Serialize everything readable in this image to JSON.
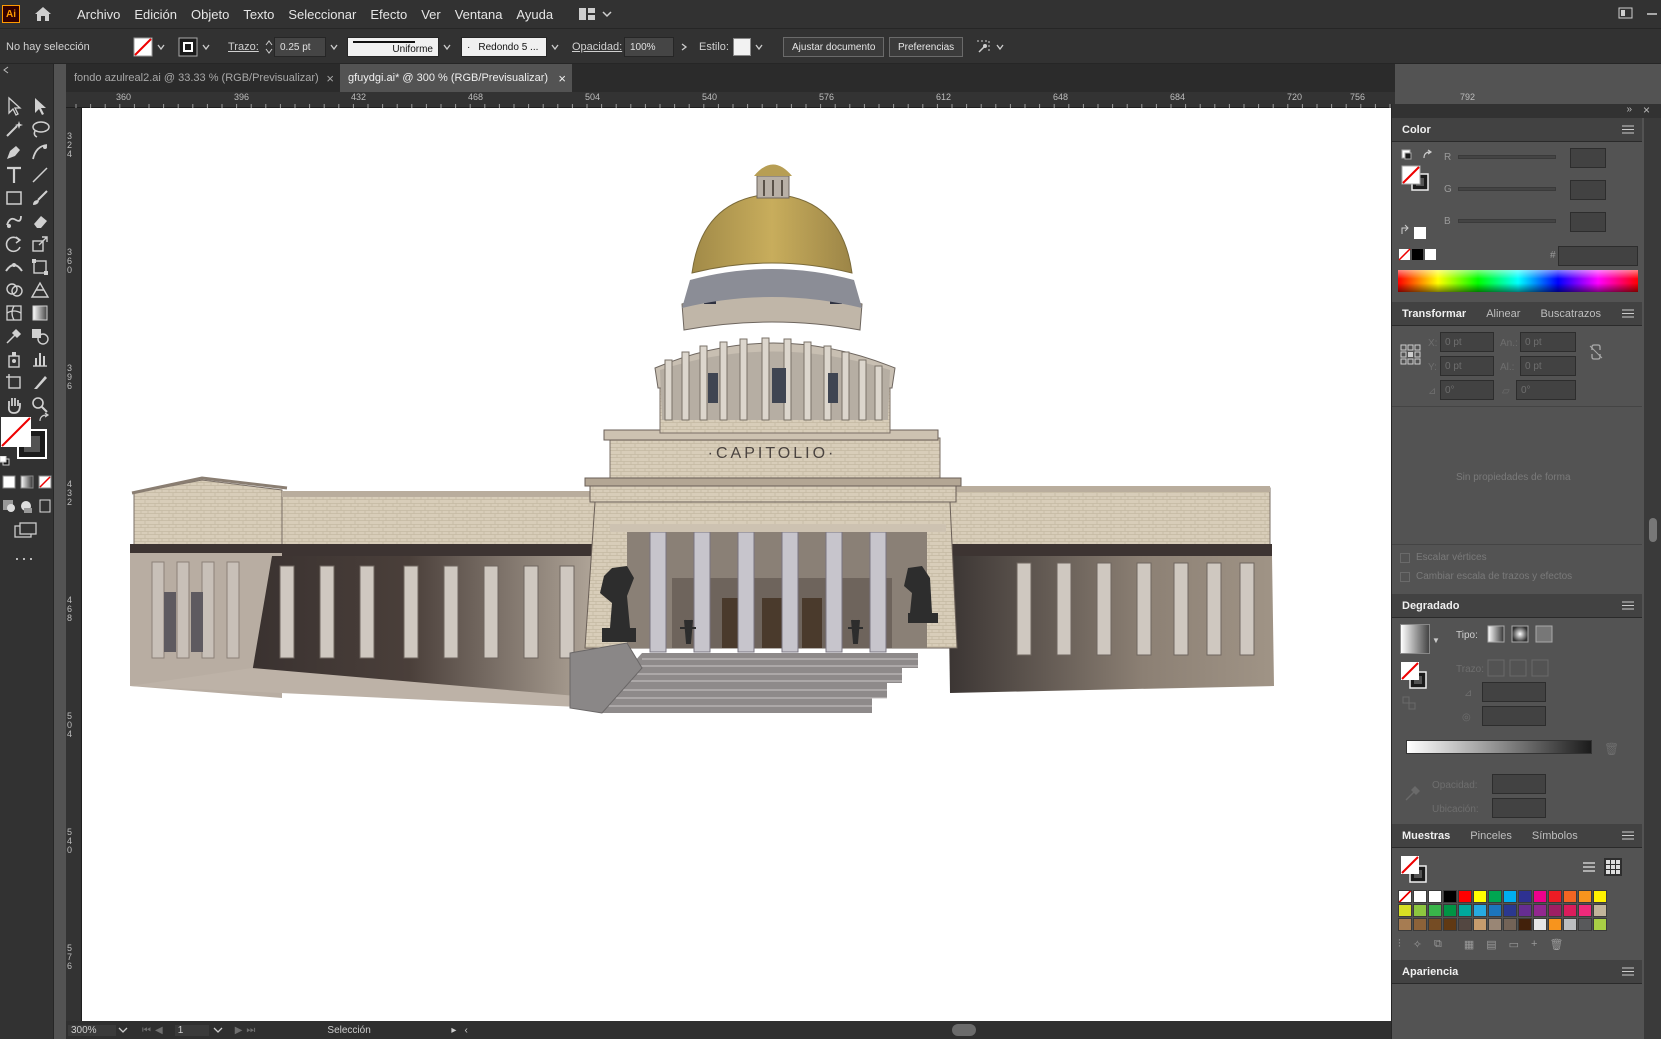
{
  "app": {
    "logo": "Ai"
  },
  "menu": [
    "Archivo",
    "Edición",
    "Objeto",
    "Texto",
    "Seleccionar",
    "Efecto",
    "Ver",
    "Ventana",
    "Ayuda"
  ],
  "control": {
    "selection_status": "No hay selección",
    "stroke_label": "Trazo:",
    "stroke_value": "0.25 pt",
    "stroke_profile": "Uniforme",
    "brush": "Redondo 5 ...",
    "opacity_label": "Opacidad:",
    "opacity_value": "100%",
    "style_label": "Estilo:",
    "fit_document": "Ajustar documento",
    "preferences": "Preferencias"
  },
  "tabs": [
    {
      "label": "fondo azulreal2.ai @ 33.33 % (RGB/Previsualizar)",
      "active": false
    },
    {
      "label": "gfuydgi.ai* @ 300 % (RGB/Previsualizar)",
      "active": true
    }
  ],
  "ruler_h": [
    "360",
    "396",
    "432",
    "468",
    "504",
    "540",
    "576",
    "612",
    "648",
    "684",
    "720",
    "756",
    "792"
  ],
  "ruler_v": [
    "3\n2\n4",
    "3\n6\n0",
    "3\n9\n6",
    "4\n3\n2",
    "4\n6\n8",
    "5\n0\n4",
    "5\n4\n0",
    "5\n7\n6"
  ],
  "artwork": {
    "inscription": "·CAPITOLIO·"
  },
  "status": {
    "zoom": "300%",
    "page": "1",
    "tool": "Selección"
  },
  "panels": {
    "color": {
      "title": "Color",
      "r_label": "R",
      "g_label": "G",
      "b_label": "B",
      "hex_label": "#",
      "spectrum_colors": [
        "#ff0000",
        "#ffff00",
        "#00ff00",
        "#00ffff",
        "#0000ff",
        "#ff00ff",
        "#ff0000"
      ]
    },
    "transform": {
      "tabs": [
        "Transformar",
        "Alinear",
        "Buscatrazos"
      ],
      "x_label": "X:",
      "x_value": "0 pt",
      "y_label": "Y:",
      "y_value": "0 pt",
      "w_label": "An.:",
      "w_value": "0 pt",
      "h_label": "Al.:",
      "h_value": "0 pt",
      "angle_value": "0°",
      "shear_value": "0°",
      "no_shape": "Sin propiedades de forma",
      "scale_corners": "Escalar vértices",
      "scale_strokes": "Cambiar escala de trazos y efectos"
    },
    "gradient": {
      "title": "Degradado",
      "type_label": "Tipo:",
      "stroke_label": "Trazo:",
      "opacity_label": "Opacidad:",
      "location_label": "Ubicación:"
    },
    "swatches": {
      "tabs": [
        "Muestras",
        "Pinceles",
        "Símbolos"
      ],
      "rows": [
        [
          "#ffffff",
          "#ffffff",
          "#ffffff",
          "#000000",
          "#ff0000",
          "#ffff00",
          "#00a651",
          "#00aeef",
          "#2e3192",
          "#ec008c",
          "#ed1c24",
          "#f26522",
          "#f7941d",
          "#fff200"
        ],
        [
          "#d7df23",
          "#8dc63f",
          "#39b54a",
          "#009444",
          "#00a99d",
          "#27aae1",
          "#1c75bc",
          "#2b388f",
          "#662d91",
          "#92278f",
          "#9e1f63",
          "#da1c5c",
          "#ee2a7b",
          "#c2b59b"
        ],
        [
          "#a67c52",
          "#8c6239",
          "#754c24",
          "#603913",
          "#534741",
          "#c69c6d",
          "#998675",
          "#736357",
          "#42210b",
          "#e6e6e6",
          "#f7941d",
          "#bcbec0",
          "#58595b",
          "#a8cf45"
        ]
      ]
    },
    "appearance": {
      "title": "Apariencia"
    }
  }
}
